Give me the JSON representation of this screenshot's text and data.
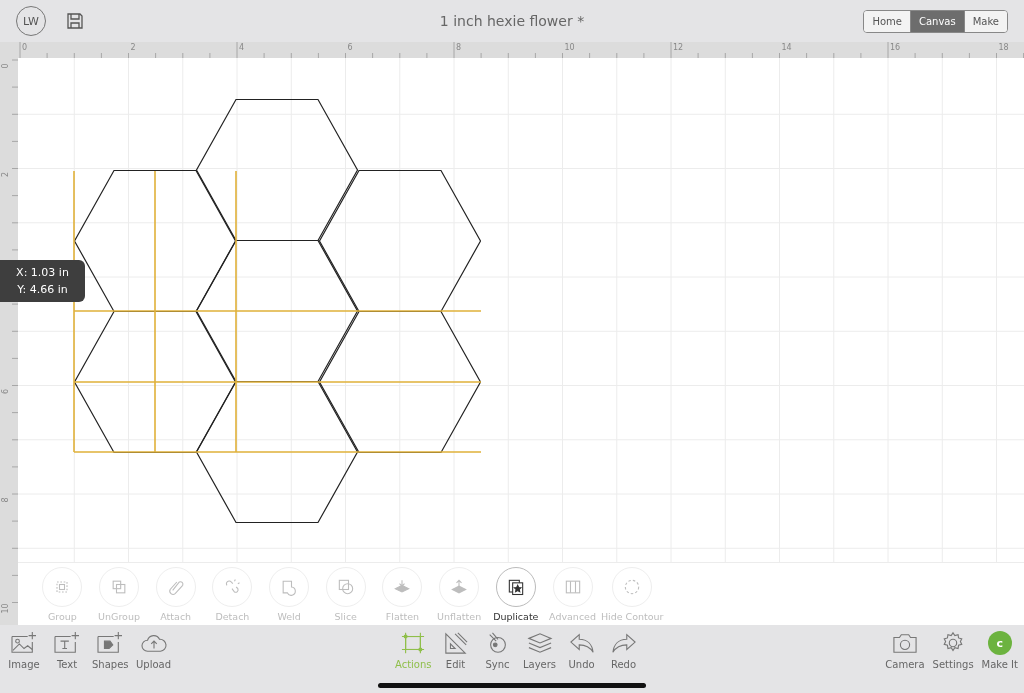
{
  "top_bar": {
    "avatar": "LW",
    "title": "1 inch hexie flower *",
    "modes": [
      {
        "label": "Home",
        "selected": false
      },
      {
        "label": "Canvas",
        "selected": true
      },
      {
        "label": "Make",
        "selected": false
      }
    ]
  },
  "ruler": {
    "horizontal": [
      "0",
      "2",
      "4",
      "6",
      "8",
      "10",
      "12",
      "14",
      "16",
      "18"
    ],
    "vertical": [
      "0",
      "2",
      "6",
      "8",
      "10"
    ]
  },
  "canvas": {
    "tooltip": [
      "X: 1.03 in",
      "Y: 4.66 in"
    ]
  },
  "actions": [
    {
      "kind": "group",
      "label": "Group",
      "disabled": true
    },
    {
      "kind": "ungroup",
      "label": "UnGroup",
      "disabled": true
    },
    {
      "kind": "attach",
      "label": "Attach",
      "disabled": true
    },
    {
      "kind": "detach",
      "label": "Detach",
      "disabled": true
    },
    {
      "kind": "weld",
      "label": "Weld",
      "disabled": true
    },
    {
      "kind": "slice",
      "label": "Slice",
      "disabled": true
    },
    {
      "kind": "flatten",
      "label": "Flatten",
      "disabled": true
    },
    {
      "kind": "unflatten",
      "label": "Unflatten",
      "disabled": true
    },
    {
      "kind": "duplicate",
      "label": "Duplicate",
      "disabled": false
    },
    {
      "kind": "advanced",
      "label": "Advanced",
      "disabled": true
    },
    {
      "kind": "contour",
      "label": "Hide Contour",
      "disabled": true
    }
  ],
  "bottom_bar": {
    "left": [
      {
        "kind": "image",
        "label": "Image"
      },
      {
        "kind": "text",
        "label": "Text"
      },
      {
        "kind": "shapes",
        "label": "Shapes"
      },
      {
        "kind": "upload",
        "label": "Upload"
      }
    ],
    "center": [
      {
        "kind": "actions",
        "label": "Actions",
        "selected": true
      },
      {
        "kind": "edit",
        "label": "Edit",
        "selected": false
      },
      {
        "kind": "sync",
        "label": "Sync",
        "selected": false
      },
      {
        "kind": "layers",
        "label": "Layers",
        "selected": false
      },
      {
        "kind": "undo",
        "label": "Undo",
        "selected": false
      },
      {
        "kind": "redo",
        "label": "Redo",
        "selected": false
      }
    ],
    "right": [
      {
        "kind": "camera",
        "label": "Camera"
      },
      {
        "kind": "settings",
        "label": "Settings"
      },
      {
        "kind": "make",
        "label": "Make It",
        "badge": "c"
      }
    ]
  }
}
